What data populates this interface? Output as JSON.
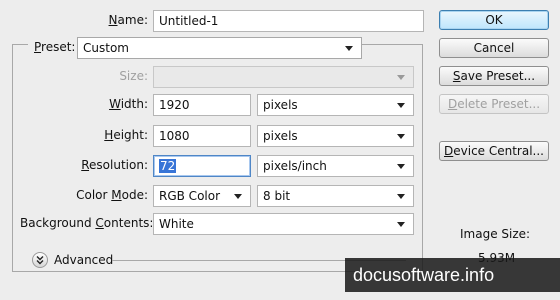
{
  "name": {
    "label": "Name:",
    "value": "Untitled-1"
  },
  "preset": {
    "label": "Preset:",
    "value": "Custom"
  },
  "size": {
    "label": "Size:",
    "value": ""
  },
  "width": {
    "label": "Width:",
    "value": "1920",
    "unit": "pixels"
  },
  "height": {
    "label": "Height:",
    "value": "1080",
    "unit": "pixels"
  },
  "resolution": {
    "label": "Resolution:",
    "value": "72",
    "unit": "pixels/inch"
  },
  "color_mode": {
    "label": "Color Mode:",
    "value": "RGB Color",
    "depth": "8 bit"
  },
  "background_contents": {
    "label": "Background Contents:",
    "value": "White"
  },
  "advanced": {
    "label": "Advanced"
  },
  "buttons": {
    "ok": "OK",
    "cancel": "Cancel",
    "save_preset": "Save Preset...",
    "delete_preset": "Delete Preset...",
    "device_central": "Device Central..."
  },
  "image_size": {
    "label": "Image Size:",
    "value": "5.93M"
  },
  "watermark": "docusoftware.info"
}
